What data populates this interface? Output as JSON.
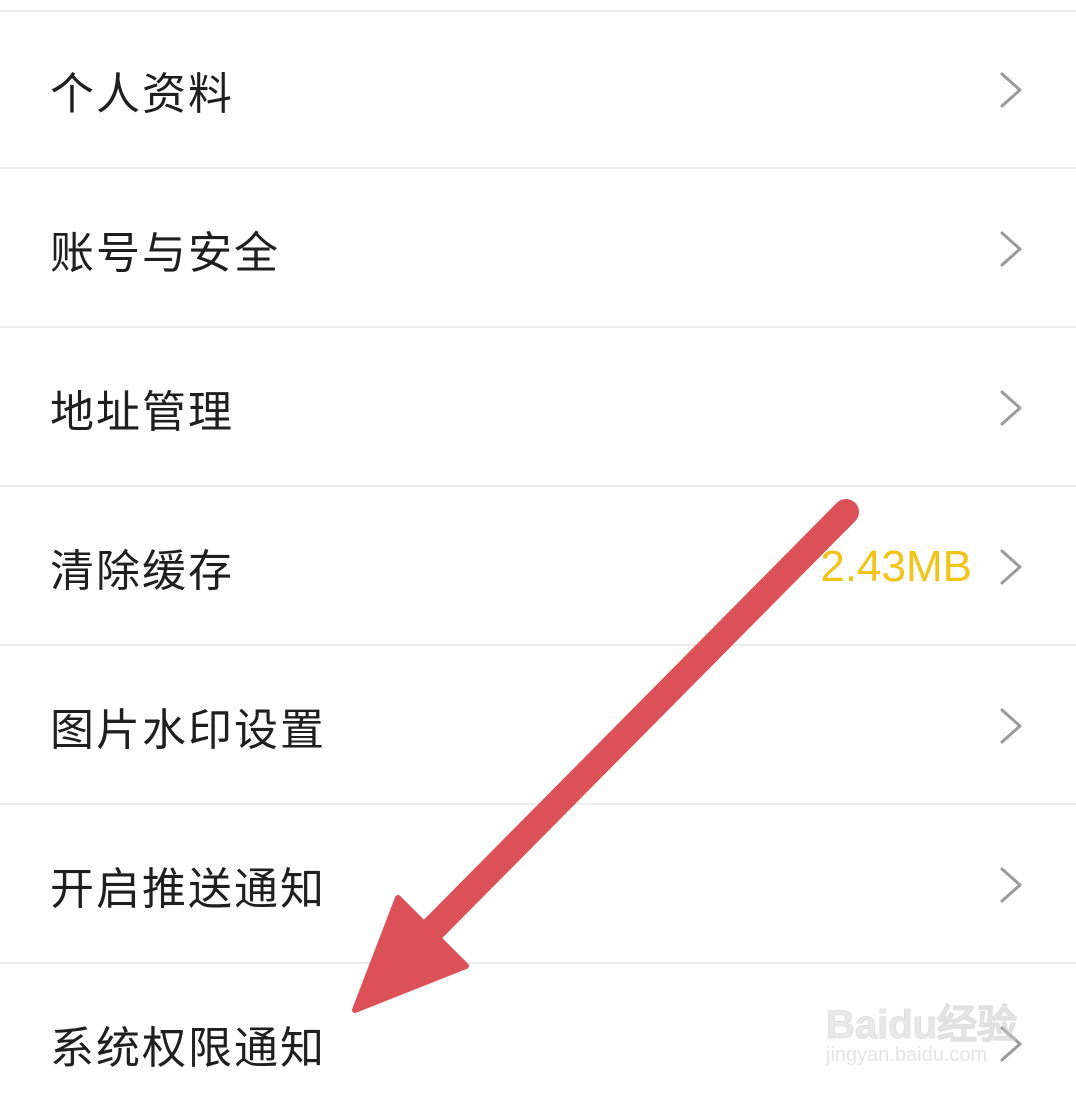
{
  "settings": {
    "items": [
      {
        "label": "个人资料"
      },
      {
        "label": "账号与安全"
      },
      {
        "label": "地址管理"
      },
      {
        "label": "清除缓存",
        "value": "2.43MB"
      },
      {
        "label": "图片水印设置"
      },
      {
        "label": "开启推送通知"
      },
      {
        "label": "系统权限通知"
      }
    ]
  },
  "colors": {
    "label": "#1f1f1f",
    "value_accent": "#f2c318",
    "chevron": "#9a9a9a",
    "divider": "#ebebeb",
    "arrow": "#dc5158"
  },
  "icons": {
    "chevron": "chevron-right-icon",
    "annotation": "arrow-annotation"
  },
  "watermark": {
    "logo": "Baidu经验",
    "sub": "jingyan.baidu.com"
  }
}
